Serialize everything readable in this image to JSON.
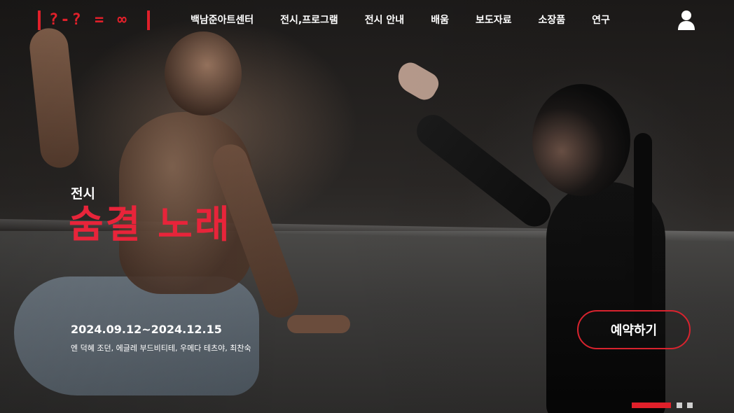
{
  "header": {
    "logo_text": "?-? = ∞",
    "nav": [
      {
        "label": "백남준아트센터"
      },
      {
        "label": "전시,프로그램"
      },
      {
        "label": "전시 안내"
      },
      {
        "label": "배움"
      },
      {
        "label": "보도자료"
      },
      {
        "label": "소장품"
      },
      {
        "label": "연구"
      }
    ],
    "user_icon": "user-icon"
  },
  "hero": {
    "kicker": "전시",
    "title": "숨결 노래",
    "dates": "2024.09.12~2024.12.15",
    "artists": "엔 덕혜 조던, 에글레 부드비티테, 우메다 테츠야, 최찬숙",
    "reserve_label": "예약하기"
  },
  "slider": {
    "slides": 3,
    "current": 1
  },
  "colors": {
    "accent": "#e0202a",
    "title": "#e8243a",
    "text": "#ffffff"
  }
}
